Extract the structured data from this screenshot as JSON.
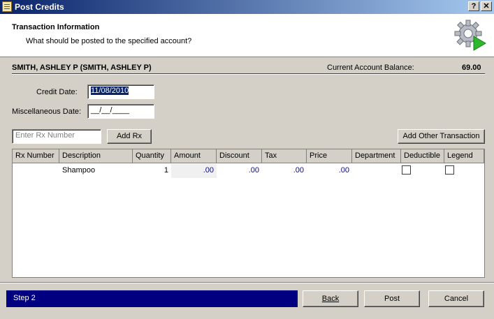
{
  "window": {
    "title": "Post Credits",
    "help_label": "?",
    "close_label": "✕"
  },
  "header": {
    "title": "Transaction Information",
    "subtitle": "What should be posted to the specified account?",
    "icon": "gear-play-icon"
  },
  "patient": {
    "name": "SMITH, ASHLEY P (SMITH, ASHLEY P)",
    "balance_label": "Current Account Balance:",
    "balance_value": "69.00"
  },
  "form": {
    "credit_date_label": "Credit Date:",
    "credit_date_value": "11/08/2010",
    "misc_date_label": "Miscellaneous Date:",
    "misc_date_value": "__/__/____",
    "rx_placeholder": "Enter Rx Number",
    "add_rx_label": "Add Rx",
    "add_other_label": "Add Other Transaction"
  },
  "grid": {
    "columns": [
      "Rx Number",
      "Description",
      "Quantity",
      "Amount",
      "Discount",
      "Tax",
      "Price",
      "Department",
      "Deductible",
      "Legend"
    ],
    "rows": [
      {
        "rx_number": "",
        "description": "Shampoo",
        "quantity": "1",
        "amount": ".00",
        "discount": ".00",
        "tax": ".00",
        "price": ".00",
        "department": "",
        "deductible": false,
        "legend": false
      }
    ]
  },
  "footer": {
    "step_label": "Step 2",
    "back_label": "Back",
    "post_label": "Post",
    "cancel_label": "Cancel"
  }
}
